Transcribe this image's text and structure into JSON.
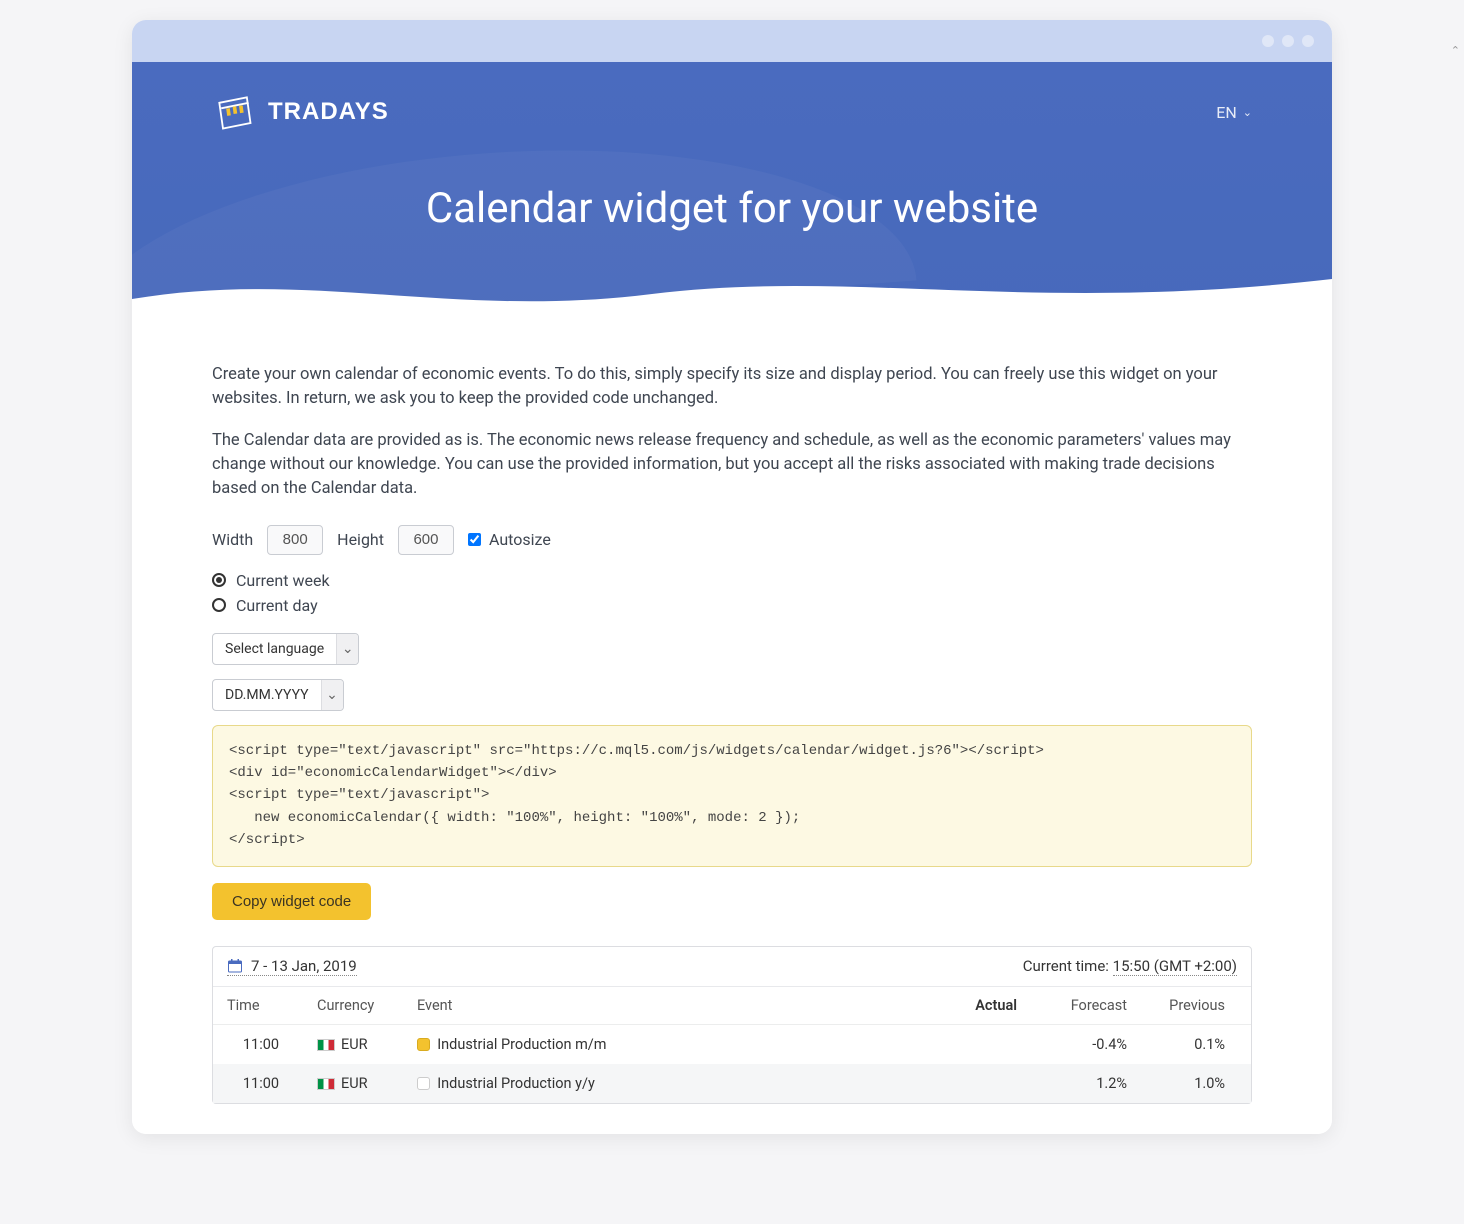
{
  "topnav": {
    "brand": "TRADAYS",
    "lang": "EN"
  },
  "hero": {
    "title": "Calendar widget for your website"
  },
  "intro": {
    "p1": "Create your own calendar of economic events. To do this, simply specify its size and display period. You can freely use this widget on your websites. In return, we ask you to keep the provided code unchanged.",
    "p2": "The Calendar data are provided as is. The economic news release frequency and schedule, as well as the economic parameters' values may change without our knowledge. You can use the provided information, but you accept all the risks associated with making trade decisions based on the Calendar data."
  },
  "size": {
    "width_label": "Width",
    "width_value": "800",
    "height_label": "Height",
    "height_value": "600",
    "autosize_label": "Autosize"
  },
  "period": {
    "current_week": "Current week",
    "current_day": "Current day"
  },
  "selects": {
    "language": "Select language",
    "date_format": "DD.MM.YYYY"
  },
  "code": {
    "text": "<script type=\"text/javascript\" src=\"https://c.mql5.com/js/widgets/calendar/widget.js?6\"></script>\n<div id=\"economicCalendarWidget\"></div>\n<script type=\"text/javascript\">\n   new economicCalendar({ width: \"100%\", height: \"100%\", mode: 2 });\n</script>"
  },
  "copy_btn": "Copy widget code",
  "widget": {
    "date_range": "7 - 13 Jan, 2019",
    "current_time_label": "Current time: ",
    "current_time_value": "15:50 (GMT +2:00)",
    "columns": {
      "time": "Time",
      "currency": "Currency",
      "event": "Event",
      "actual": "Actual",
      "forecast": "Forecast",
      "previous": "Previous"
    },
    "rows": [
      {
        "time": "11:00",
        "currency": "EUR",
        "flag": "it",
        "importance": "mid",
        "event": "Industrial Production m/m",
        "actual": "",
        "forecast": "-0.4%",
        "previous": "0.1%"
      },
      {
        "time": "11:00",
        "currency": "EUR",
        "flag": "it",
        "importance": "low",
        "event": "Industrial Production y/y",
        "actual": "",
        "forecast": "1.2%",
        "previous": "1.0%"
      }
    ]
  }
}
